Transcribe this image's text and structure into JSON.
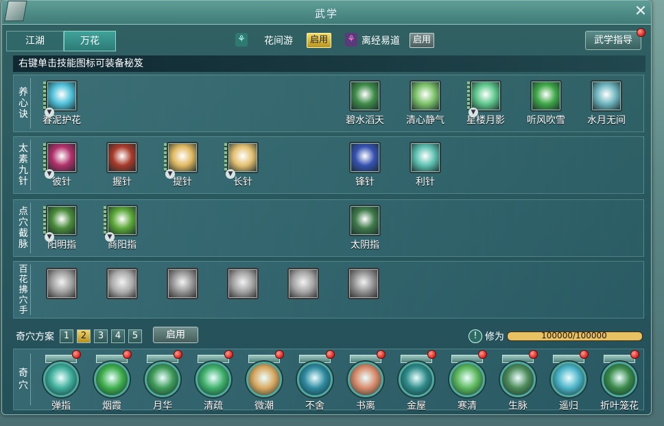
{
  "window": {
    "title": "武学"
  },
  "tabs": [
    {
      "label": "江湖"
    },
    {
      "label": "万花"
    }
  ],
  "schools": [
    {
      "name": "花间游",
      "enable_label": "启用"
    },
    {
      "name": "离经易道",
      "enable_label": "启用"
    }
  ],
  "guide_label": "武学指导",
  "hint": "右键单击技能图标可装备秘笈",
  "rows": [
    {
      "label": [
        "养",
        "心",
        "诀"
      ],
      "skills": [
        {
          "name": "春泥护花",
          "color": "#4fc0d8"
        },
        {
          "name": "碧水滔天",
          "color": "#3f8c4a"
        },
        {
          "name": "清心静气",
          "color": "#7cc26a"
        },
        {
          "name": "星楼月影",
          "color": "#5fc88c"
        },
        {
          "name": "听风吹雪",
          "color": "#3fa848"
        },
        {
          "name": "水月无间",
          "color": "#6fb6c0"
        }
      ]
    },
    {
      "label": [
        "太",
        "素",
        "九",
        "针"
      ],
      "skills": [
        {
          "name": "彼针",
          "color": "#b0306a"
        },
        {
          "name": "握针",
          "color": "#a83a2a"
        },
        {
          "name": "提针",
          "color": "#e0b860"
        },
        {
          "name": "长针",
          "color": "#e4c070"
        },
        {
          "name": "锋针",
          "color": "#3552b0"
        },
        {
          "name": "利针",
          "color": "#5cc0b0"
        }
      ]
    },
    {
      "label": [
        "点",
        "穴",
        "截",
        "脉"
      ],
      "skills": [
        {
          "name": "阳明指",
          "color": "#4a8a3a"
        },
        {
          "name": "商阳指",
          "color": "#5ca838"
        },
        {
          "name": "太阴指",
          "color": "#3f7a4a"
        }
      ]
    },
    {
      "label": [
        "百",
        "花",
        "拂",
        "穴",
        "手"
      ],
      "skills": [
        {
          "name": "",
          "color": "#9a9a9a"
        },
        {
          "name": "",
          "color": "#a8a8a8"
        },
        {
          "name": "",
          "color": "#8e8e8e"
        },
        {
          "name": "",
          "color": "#9c9c9c"
        },
        {
          "name": "",
          "color": "#a0a0a0"
        },
        {
          "name": "",
          "color": "#8a8a8a"
        }
      ]
    }
  ],
  "plan": {
    "label": "奇穴方案",
    "numbers": [
      "1",
      "2",
      "3",
      "4",
      "5"
    ],
    "selected": "2",
    "enable_label": "启用"
  },
  "cultivation": {
    "label": "修为",
    "value": "100000/100000",
    "fraction": 1.0
  },
  "qixue": {
    "label": [
      "奇",
      "穴"
    ],
    "nodes": [
      {
        "name": "弹指",
        "color": "#3fae9c"
      },
      {
        "name": "烟霞",
        "color": "#3fae4c"
      },
      {
        "name": "月华",
        "color": "#3e9a58"
      },
      {
        "name": "清疏",
        "color": "#3fb06a"
      },
      {
        "name": "微潮",
        "color": "#d8a860"
      },
      {
        "name": "不舍",
        "color": "#2f8aa0"
      },
      {
        "name": "书离",
        "color": "#d88a6a"
      },
      {
        "name": "金屋",
        "color": "#2f8c8a"
      },
      {
        "name": "寒清",
        "color": "#5cb85c"
      },
      {
        "name": "生脉",
        "color": "#4c8a58"
      },
      {
        "name": "遥归",
        "color": "#4cb4c8"
      },
      {
        "name": "折叶笼花",
        "color": "#3a8a4a"
      }
    ]
  }
}
